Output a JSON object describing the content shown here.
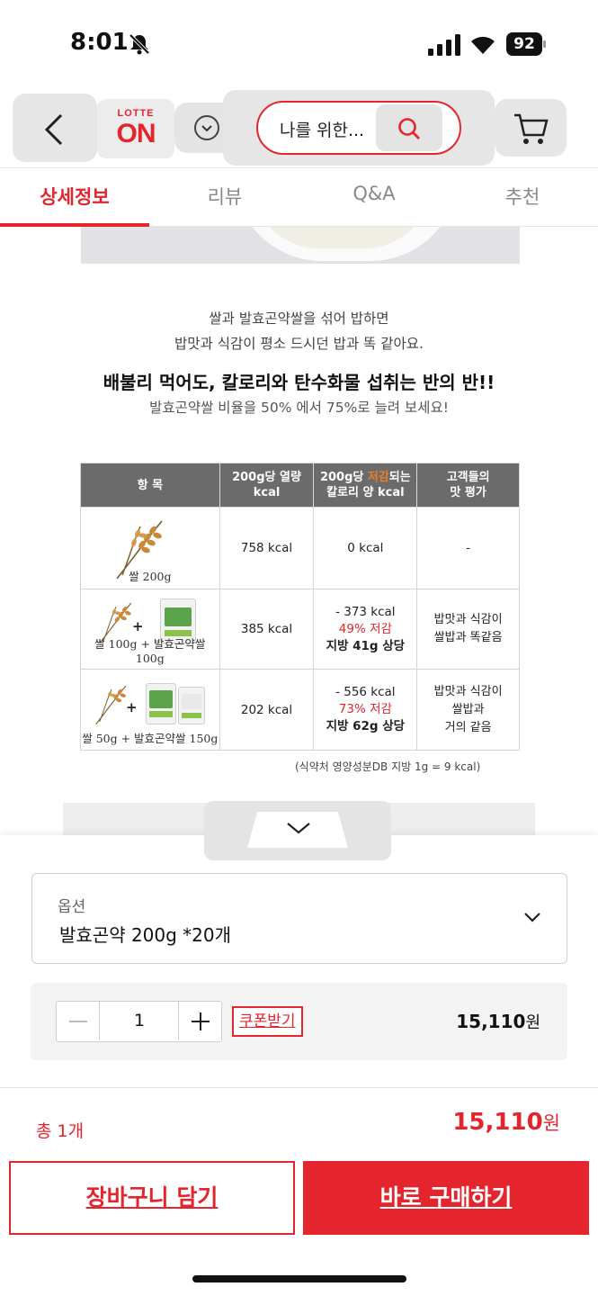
{
  "status": {
    "time": "8:01",
    "battery": "92"
  },
  "header": {
    "logo_small": "LOTTE",
    "logo_big": "ON",
    "search_text": "나를 위한..."
  },
  "tabs": [
    {
      "label": "상세정보",
      "active": true
    },
    {
      "label": "리뷰"
    },
    {
      "label": "Q&A"
    },
    {
      "label": "추천"
    }
  ],
  "content": {
    "line1": "쌀과 발효곤약쌀을 섞어 밥하면",
    "line2": "밥맛과 식감이 평소 드시던 밥과 똑 같아요.",
    "headline": "배불리 먹어도, 칼로리와 탄수화물 섭취는 반의 반!!",
    "subline": "발효곤약쌀 비율을 50% 에서 75%로 늘려 보세요!",
    "table": {
      "headers": {
        "item": "항 목",
        "kcal_a": "200g당 열량",
        "kcal_b": "kcal",
        "red_a1": "200g당 ",
        "red_a2": "저감",
        "red_a3": "되는",
        "red_b": "칼로리 양 kcal",
        "rev_a": "고객들의",
        "rev_b": "맛 평가"
      },
      "rows": [
        {
          "caption": "쌀 200g",
          "kcal": "758 kcal",
          "reduce": "0 kcal",
          "pct": "",
          "fat": "",
          "review1": "-",
          "review2": "",
          "review3": ""
        },
        {
          "caption": "쌀 100g + 발효곤약쌀 100g",
          "kcal": "385 kcal",
          "reduce": "- 373 kcal",
          "pct": "49% 저감",
          "fat": "지방 41g 상당",
          "review1": "밥맛과 식감이",
          "review2": "쌀밥과 똑같음",
          "review3": ""
        },
        {
          "caption": "쌀 50g + 발효곤약쌀 150g",
          "kcal": "202 kcal",
          "reduce": "- 556 kcal",
          "pct": "73% 저감",
          "fat": "지방 62g 상당",
          "review1": "밥맛과 식감이",
          "review2": "쌀밥과",
          "review3": "거의 같음"
        }
      ],
      "note": "(식약처 영양성분DB 지방 1g = 9 kcal)"
    }
  },
  "sheet": {
    "option_label": "옵션",
    "option_value": "발효곤약 200g *20개",
    "quantity": "1",
    "coupon": "쿠폰받기",
    "item_price": "15,110",
    "won": "원",
    "total_label": "총 1개",
    "total_price": "15,110",
    "cart_button": "장바구니 담기",
    "buy_button": "바로 구매하기"
  },
  "colors": {
    "brand": "#e4252e",
    "accent": "#f07c20",
    "header_gray": "#6b6b6b"
  },
  "icons": [
    "bell-slash-icon",
    "signal-icon",
    "wifi-icon",
    "battery-icon",
    "back-icon",
    "chevron-down-icon",
    "search-icon",
    "cart-icon",
    "wheat-icon",
    "rice-bag-icon"
  ]
}
